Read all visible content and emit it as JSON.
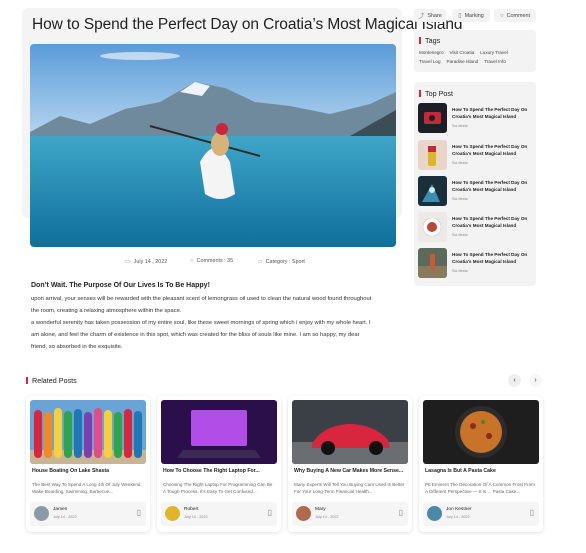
{
  "post": {
    "title": "How to Spend the Perfect Day on Croatia’s Most Magical Island",
    "meta": {
      "date": "July 14 , 2022",
      "comments": "Comments : 35",
      "category": "Category : Sport"
    },
    "lead": "Don’t Wait. The Purpose Of Our Lives Is To Be Happy!",
    "paragraphs": [
      "upon arrival, your senses will be rewarded with the pleasant scent of lemongrass oil used to clean the natural wood found throughout",
      "the room, creating a relaxing atmosphere within the space.",
      "a wonderful serenity has taken possession of my entire soul, like these sweet mornings of spring which i enjoy with my whole heart. I",
      "am alone, and feel the charm of existence in this spot, which was created for the bliss of souls like mine. I am so happy, my dear",
      "friend, so absorbed in the exquisite."
    ]
  },
  "actions": {
    "share": "Share",
    "marking": "Marking",
    "comment": "Comment"
  },
  "tags": {
    "heading": "Tags",
    "items": [
      "Montenegro",
      "Visit Croatia",
      "Luxury Travel",
      "Travel Log",
      "Paradise Island",
      "Travel Info"
    ]
  },
  "top_post": {
    "heading": "Top Post",
    "items": [
      {
        "title": "How To Spend The Perfect Day On Croatia's Most Magical Island",
        "category": "Sci-fiesta"
      },
      {
        "title": "How To Spend The Perfect Day On Croatia's Most Magical Island",
        "category": "Sci-fiesta"
      },
      {
        "title": "How To Spend The Perfect Day On Croatia's Most Magical Island",
        "category": "Sci-fiesta"
      },
      {
        "title": "How To Spend The Perfect Day On Croatia's Most Magical Island",
        "category": "Sci-fiesta"
      },
      {
        "title": "How To Spend The Perfect Day On Croatia's Most Magical Island",
        "category": "Sci-fiesta"
      }
    ]
  },
  "related": {
    "heading": "Related Posts",
    "prev_icon": "‹",
    "next_icon": "›",
    "items": [
      {
        "title": "House Boating On Lake Shasta",
        "excerpt": "The Best Way To Spend A Long 4th Of July Weekend, Wake Boarding, Swimming, Barbecue...",
        "author": "James",
        "date": "July 14 , 2022"
      },
      {
        "title": "How To Choose The Right Laptop For...",
        "excerpt": "Choosing The Right Laptop For Programming Can Be A Tough Process. It's Easy To Get Confused...",
        "author": "Robert",
        "date": "July 14 , 2022"
      },
      {
        "title": "Why Buying A New Car Makes More Sense...",
        "excerpt": "Many Experts Will Tell You Buying Cars Used Is Better For Your Long-Term Financial Health...",
        "author": "Mary",
        "date": "July 14 , 2022"
      },
      {
        "title": "Lasagna Is But A Pasta Cake",
        "excerpt": "Ptt Eminent The Decoration Of A Common Frost From A Different Perspective — It Is ... Pasta Cake...",
        "author": "Jon Kestner",
        "date": "July 14 , 2022"
      }
    ]
  },
  "colors": {
    "accent": "#d7263d",
    "card_bg": "#f3f3f3"
  },
  "icons": {
    "calendar": "calendar-icon",
    "comment": "comment-icon",
    "category": "folder-icon",
    "share": "share-icon",
    "bookmark": "bookmark-icon"
  }
}
